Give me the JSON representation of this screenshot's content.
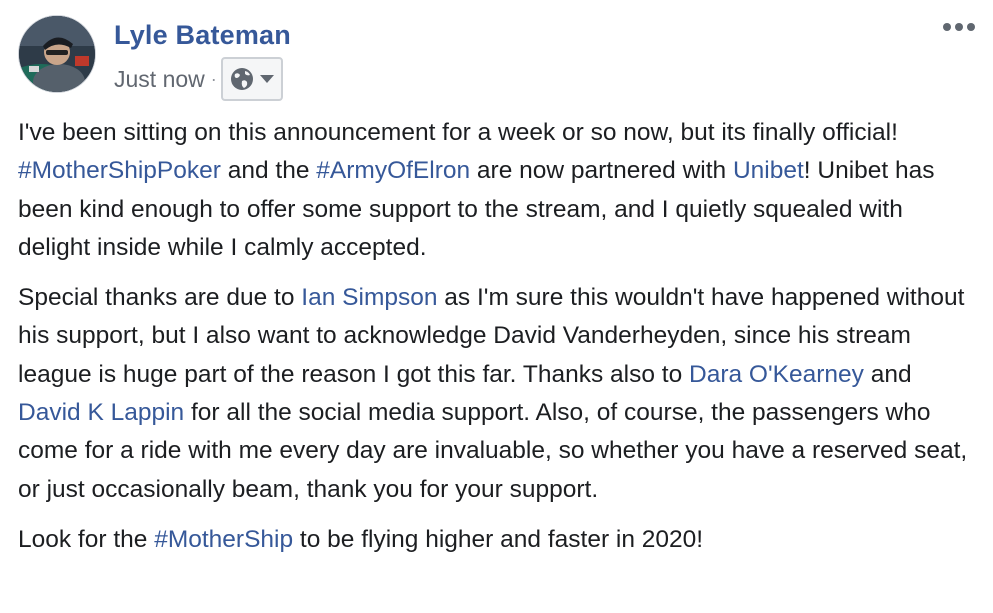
{
  "post": {
    "author": "Lyle Bateman",
    "timestamp": "Just now",
    "separator": "·",
    "audience_icon": "globe-icon",
    "menu_icon": "ellipsis-icon",
    "paragraphs": [
      [
        {
          "text": "I've been sitting on this announcement for a week or so now, but its finally official! ",
          "link": false
        },
        {
          "text": "#MotherShipPoker",
          "link": true
        },
        {
          "text": " and the ",
          "link": false
        },
        {
          "text": "#ArmyOfElron",
          "link": true
        },
        {
          "text": " are now partnered with ",
          "link": false
        },
        {
          "text": "Unibet",
          "link": true
        },
        {
          "text": "! Unibet has been kind enough to offer some support to the stream, and I quietly squealed with delight inside while I calmly accepted.",
          "link": false
        }
      ],
      [
        {
          "text": "Special thanks are due to ",
          "link": false
        },
        {
          "text": "Ian Simpson",
          "link": true
        },
        {
          "text": " as I'm sure this wouldn't have happened without his support, but I also want to acknowledge David Vanderheyden, since his stream league is huge part of the reason I got this far. Thanks also to ",
          "link": false
        },
        {
          "text": "Dara O'Kearney",
          "link": true
        },
        {
          "text": " and ",
          "link": false
        },
        {
          "text": "David K Lappin",
          "link": true
        },
        {
          "text": " for all the social media support. Also, of course, the passengers who come for a ride with me every day are invaluable, so whether you have a reserved seat, or just occasionally beam, thank you for your support.",
          "link": false
        }
      ],
      [
        {
          "text": "Look for the ",
          "link": false
        },
        {
          "text": "#MotherShip",
          "link": true
        },
        {
          "text": " to be flying higher and faster in 2020!",
          "link": false
        }
      ]
    ]
  },
  "colors": {
    "link": "#365899",
    "text": "#1c1e21",
    "meta": "#616770"
  }
}
